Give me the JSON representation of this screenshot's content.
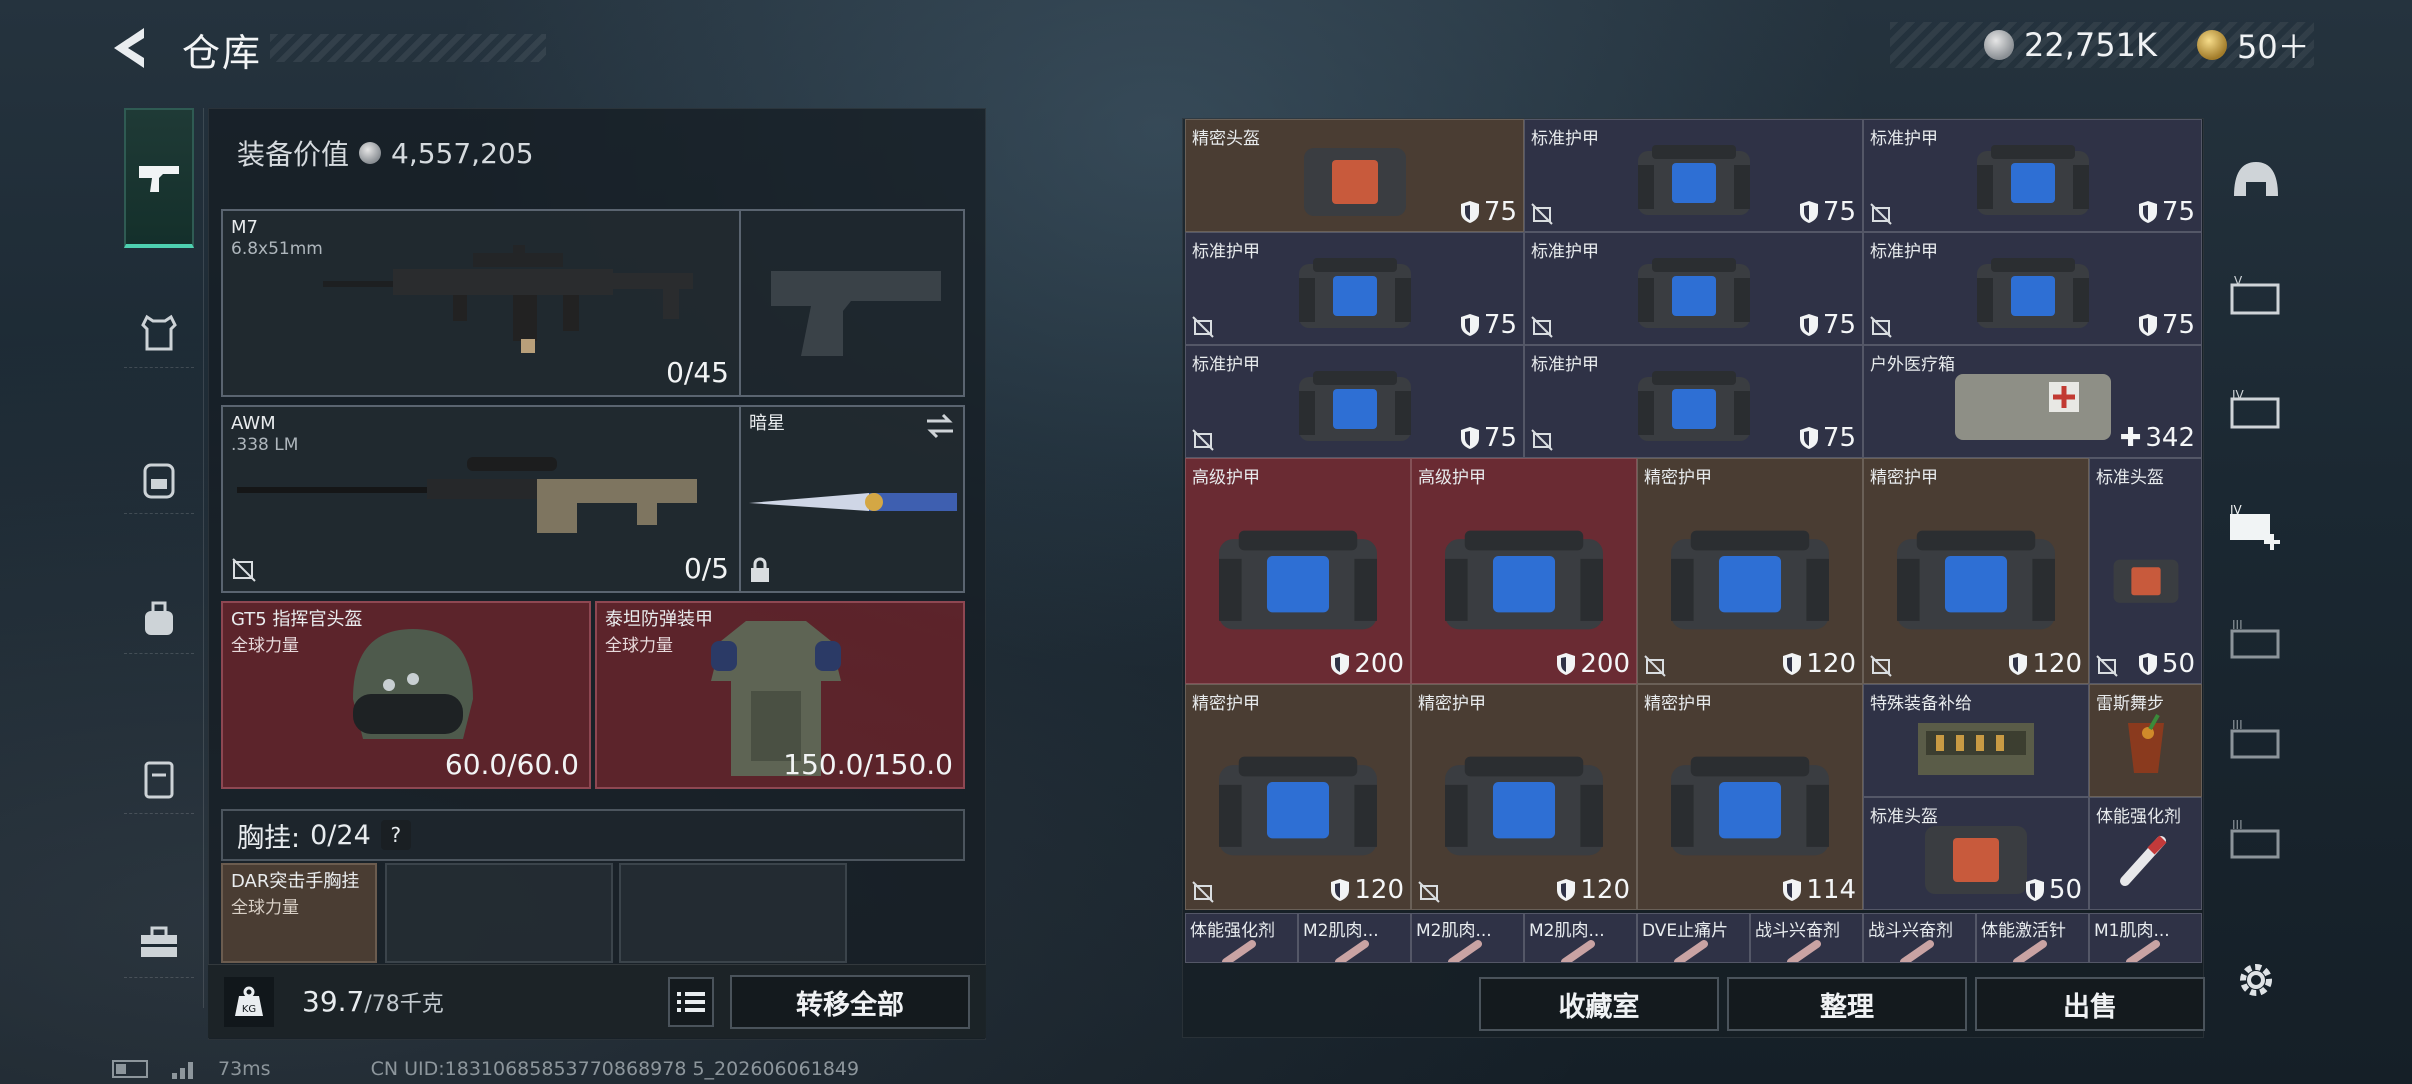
{
  "header": {
    "title": "仓库"
  },
  "currency": {
    "silver": "22,751K",
    "gold": "50＋"
  },
  "left_rail": [
    {
      "icon": "pistol-icon",
      "active": true
    },
    {
      "icon": "vest-icon"
    },
    {
      "icon": "backpack-icon"
    },
    {
      "icon": "bag-icon"
    },
    {
      "icon": "locker-icon"
    },
    {
      "icon": "toolbox-icon"
    }
  ],
  "equipment": {
    "value_label": "装备价值",
    "value": "4,557,205",
    "primary": {
      "name": "M7",
      "ammo": "6.8x51mm",
      "count": "0/45"
    },
    "secondary": {
      "name": "AWM",
      "ammo": ".338 LM",
      "count": "0/5"
    },
    "melee": {
      "name": "暗星"
    },
    "helmet": {
      "name": "GT5 指挥官头盔",
      "sub": "全球力量",
      "durability": "60.0/60.0"
    },
    "armor": {
      "name": "泰坦防弹装甲",
      "sub": "全球力量",
      "durability": "150.0/150.0"
    },
    "chest_rig": {
      "label": "胸挂:",
      "count": "0/24",
      "help": "?"
    },
    "rig_item": {
      "name": "DAR突击手胸挂",
      "sub": "全球力量"
    },
    "weight": {
      "value": "39.7",
      "max": "/78千克",
      "icon_text": "KG"
    },
    "transfer_all": "转移全部"
  },
  "inventory": {
    "items": [
      {
        "name": "精密头盔",
        "value": "75",
        "color": "brown",
        "kind": "helmet",
        "nofx": false
      },
      {
        "name": "标准护甲",
        "value": "75",
        "color": "blue",
        "kind": "bag",
        "nofx": true
      },
      {
        "name": "标准护甲",
        "value": "75",
        "color": "blue",
        "kind": "bag",
        "nofx": true
      },
      {
        "name": "标准护甲",
        "value": "75",
        "color": "blue",
        "kind": "bag",
        "nofx": true
      },
      {
        "name": "标准护甲",
        "value": "75",
        "color": "blue",
        "kind": "bag",
        "nofx": true
      },
      {
        "name": "标准护甲",
        "value": "75",
        "color": "blue",
        "kind": "bag",
        "nofx": true
      },
      {
        "name": "标准护甲",
        "value": "75",
        "color": "blue",
        "kind": "bag",
        "nofx": true
      },
      {
        "name": "标准护甲",
        "value": "75",
        "color": "blue",
        "kind": "bag",
        "nofx": true
      },
      {
        "name": "户外医疗箱",
        "value": "342",
        "color": "blue",
        "kind": "medkit",
        "nofx": false,
        "plus": true
      },
      {
        "name": "高级护甲",
        "value": "200",
        "color": "red",
        "kind": "bagL",
        "nofx": false
      },
      {
        "name": "高级护甲",
        "value": "200",
        "color": "red",
        "kind": "bagL",
        "nofx": false
      },
      {
        "name": "精密护甲",
        "value": "120",
        "color": "brown",
        "kind": "bagL",
        "nofx": true
      },
      {
        "name": "精密护甲",
        "value": "120",
        "color": "brown",
        "kind": "bagL",
        "nofx": true
      },
      {
        "name": "标准头盔",
        "value": "50",
        "color": "blue",
        "kind": "helmetT",
        "nofx": true
      },
      {
        "name": "精密护甲",
        "value": "120",
        "color": "brown",
        "kind": "bagL",
        "nofx": true
      },
      {
        "name": "精密护甲",
        "value": "120",
        "color": "brown",
        "kind": "bagL",
        "nofx": true
      },
      {
        "name": "精密护甲",
        "value": "114",
        "color": "brown",
        "kind": "bagL",
        "nofx": false
      },
      {
        "name": "特殊装备补给",
        "value": "",
        "color": "blue",
        "kind": "crate",
        "nofx": false
      },
      {
        "name": "雷斯舞步",
        "value": "",
        "color": "brown",
        "kind": "drink",
        "nofx": false
      },
      {
        "name": "标准头盔",
        "value": "50",
        "color": "blue",
        "kind": "helmet",
        "nofx": false
      },
      {
        "name": "体能强化剂",
        "value": "",
        "color": "blue",
        "kind": "syringe",
        "nofx": false
      }
    ],
    "bottom_row": [
      "体能强化剂",
      "M2肌肉...",
      "M2肌肉...",
      "M2肌肉...",
      "DVE止痛片",
      "战斗兴奋剂",
      "战斗兴奋剂",
      "体能激活针",
      "M1肌肉..."
    ],
    "buttons": {
      "collection": "收藏室",
      "sort": "整理",
      "sell": "出售"
    }
  },
  "right_rail": [
    {
      "icon": "helmet-tab-icon"
    },
    {
      "icon": "tier5-case-icon",
      "label": "V"
    },
    {
      "icon": "tier4-case-icon",
      "label": "IV"
    },
    {
      "icon": "tier4-add-icon",
      "label": "IV"
    },
    {
      "icon": "tier3-case-icon",
      "label": "III"
    },
    {
      "icon": "tier3-case-icon",
      "label": "III"
    },
    {
      "icon": "tier3-case-icon",
      "label": "III"
    }
  ],
  "status": {
    "ping": "73ms",
    "uid": "CN UID:18310685853770868978 5_202606061849"
  }
}
